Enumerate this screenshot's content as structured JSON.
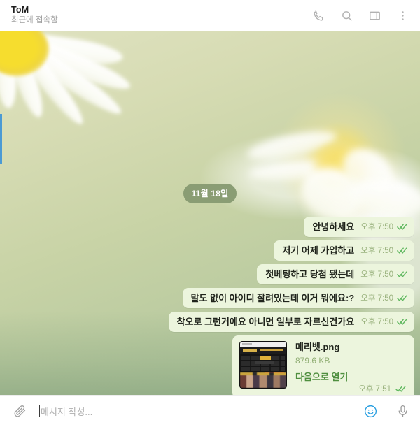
{
  "header": {
    "contact_name": "ToM",
    "status": "최근에 접속함",
    "icons": {
      "call": "phone-icon",
      "search": "search-icon",
      "panel": "side-panel-icon",
      "menu": "more-vertical-icon"
    }
  },
  "chat": {
    "date_separator": "11월 18일",
    "messages": [
      {
        "text": "안녕하세요",
        "time": "오후 7:50",
        "status": "read"
      },
      {
        "text": "저기 어제 가입하고",
        "time": "오후 7:50",
        "status": "read"
      },
      {
        "text": "첫베팅하고 당첨 됐는데",
        "time": "오후 7:50",
        "status": "read"
      },
      {
        "text": "말도 없이 아이디 잘려있는데 이거 뭐에요:?",
        "time": "오후 7:50",
        "status": "read"
      },
      {
        "text": "착오로 그런거에요 아니면 일부로 자르신건가요",
        "time": "오후 7:50",
        "status": "read"
      }
    ],
    "file_message": {
      "file_name": "메리벳.png",
      "file_size": "879.6 KB",
      "open_label": "다음으로 열기",
      "time": "오후 7:51",
      "status": "read",
      "thumbnail_name": "betting-site-screenshot-thumbnail"
    }
  },
  "composer": {
    "attach_icon": "paperclip-icon",
    "placeholder": "메시지 작성...",
    "emoji_icon": "smiley-icon",
    "mic_icon": "microphone-icon"
  },
  "colors": {
    "bubble_bg": "#ecf5dd",
    "date_pill_bg": "#8a9d74",
    "time_text": "#9ab27e",
    "tick_green": "#5fb85f",
    "open_link": "#4f8f3f",
    "emoji_blue": "#2a9fe0"
  }
}
